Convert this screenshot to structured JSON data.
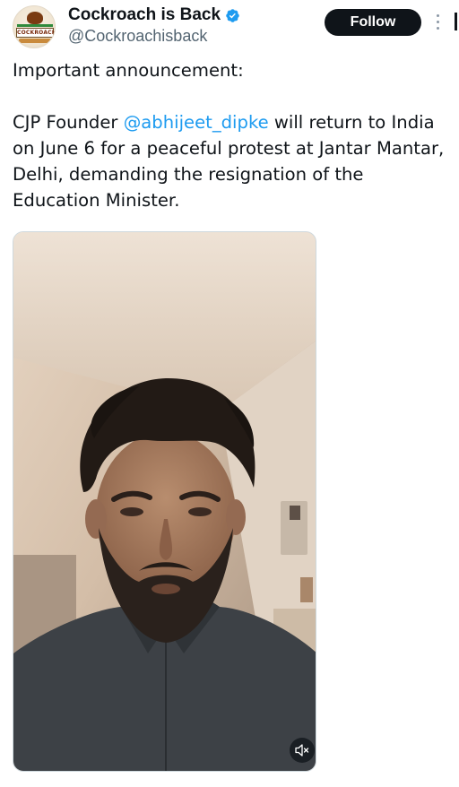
{
  "author": {
    "display_name": "Cockroach is Back",
    "handle": "@Cockroachisback",
    "avatar_icon": "cockroach-party-logo",
    "avatar_text": "COCKROACH",
    "verified_color": "#1d9bf0"
  },
  "actions": {
    "follow_label": "Follow",
    "more_icon": "vertical-ellipsis-icon"
  },
  "post": {
    "paragraph1": "Important announcement:",
    "paragraph2_before": "CJP Founder ",
    "mention": "@abhijeet_dipke",
    "paragraph2_after": " will return to India on June 6 for a peaceful protest at Jantar Mantar, Delhi, demanding the resignation of the Education Minister."
  },
  "media": {
    "type": "video",
    "mute_icon": "speaker-muted-icon"
  },
  "colors": {
    "text": "#0f1419",
    "secondary": "#536471",
    "link": "#1d9bf0",
    "button_bg": "#0f1419"
  }
}
